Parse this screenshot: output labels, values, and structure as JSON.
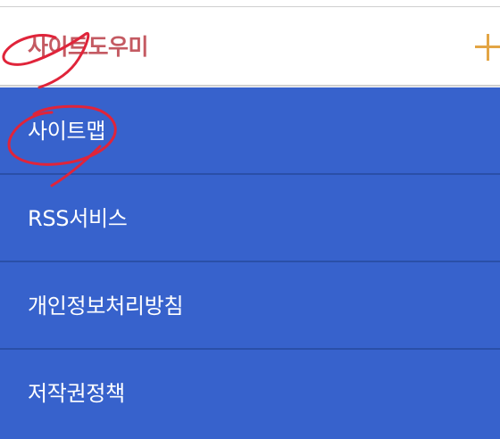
{
  "header": {
    "title": "사이트도우미",
    "expand_icon": "plus-icon",
    "title_color": "#c45a62",
    "icon_color": "#e3a544"
  },
  "menu": {
    "background_color": "#3762cc",
    "items": [
      {
        "label": "사이트맵"
      },
      {
        "label": "RSS서비스"
      },
      {
        "label": "개인정보처리방침"
      },
      {
        "label": "저작권정책"
      }
    ]
  },
  "annotations": {
    "stroke_color": "#e0243a"
  }
}
